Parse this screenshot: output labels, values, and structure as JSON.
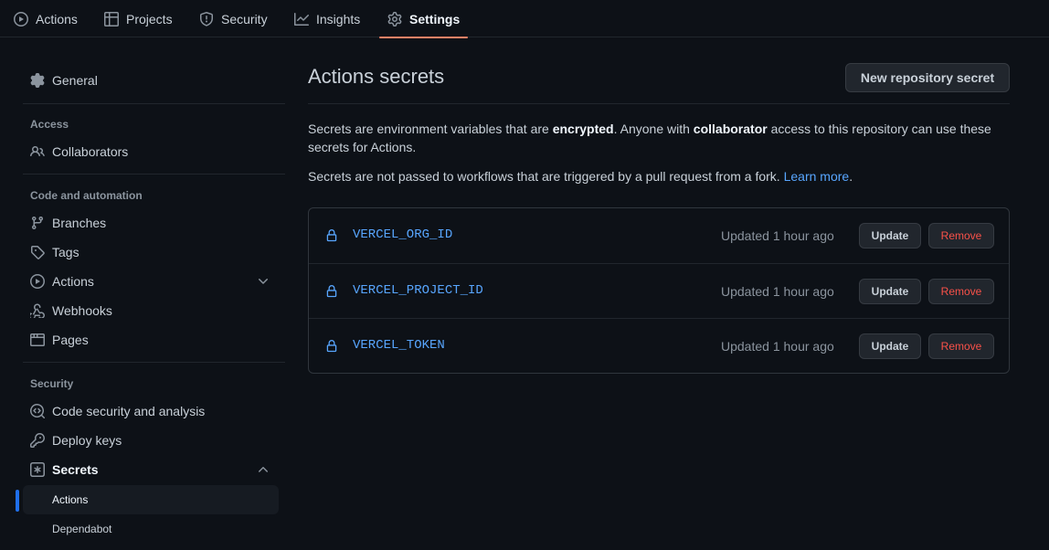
{
  "topnav": {
    "tabs": [
      {
        "label": "Actions",
        "icon": "play-icon"
      },
      {
        "label": "Projects",
        "icon": "table-icon"
      },
      {
        "label": "Security",
        "icon": "shield-icon"
      },
      {
        "label": "Insights",
        "icon": "graph-icon"
      },
      {
        "label": "Settings",
        "icon": "gear-icon",
        "active": true
      }
    ]
  },
  "sidebar": {
    "general": "General",
    "access_heading": "Access",
    "collaborators": "Collaborators",
    "code_heading": "Code and automation",
    "branches": "Branches",
    "tags": "Tags",
    "actions": "Actions",
    "webhooks": "Webhooks",
    "pages": "Pages",
    "security_heading": "Security",
    "code_security": "Code security and analysis",
    "deploy_keys": "Deploy keys",
    "secrets": "Secrets",
    "secrets_sub": [
      "Actions",
      "Dependabot"
    ]
  },
  "main": {
    "title": "Actions secrets",
    "new_button": "New repository secret",
    "desc1_a": "Secrets are environment variables that are ",
    "desc1_b": "encrypted",
    "desc1_c": ". Anyone with ",
    "desc1_d": "collaborator",
    "desc1_e": " access to this repository can use these secrets for Actions.",
    "desc2_a": "Secrets are not passed to workflows that are triggered by a pull request from a fork. ",
    "desc2_link": "Learn more",
    "desc2_end": ".",
    "secrets": [
      {
        "name": "VERCEL_ORG_ID",
        "updated": "Updated 1 hour ago",
        "update_label": "Update",
        "remove_label": "Remove"
      },
      {
        "name": "VERCEL_PROJECT_ID",
        "updated": "Updated 1 hour ago",
        "update_label": "Update",
        "remove_label": "Remove"
      },
      {
        "name": "VERCEL_TOKEN",
        "updated": "Updated 1 hour ago",
        "update_label": "Update",
        "remove_label": "Remove"
      }
    ]
  },
  "colors": {
    "background": "#0d1117",
    "accent_link": "#58a6ff",
    "active_tab_underline": "#f78166",
    "danger": "#f85149"
  }
}
